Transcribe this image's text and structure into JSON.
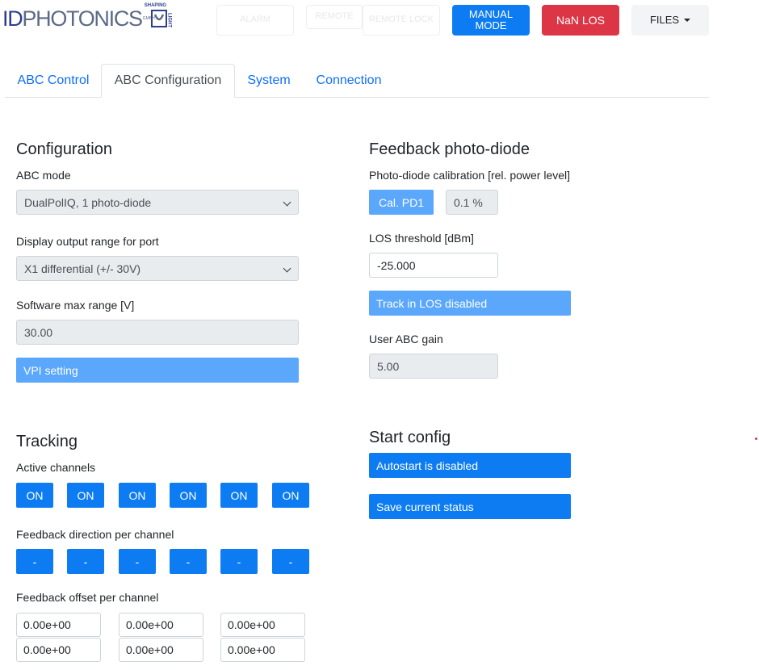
{
  "header": {
    "logo": {
      "id": "ID",
      "rest": "PHOTONICS",
      "shaping": "SHAPING",
      "gmbh": "GMBH",
      "light": "LIGHT"
    },
    "ghost_buttons": [
      "ALARM",
      "REMOTE",
      "REMOTE LOCK"
    ],
    "manual_mode": "MANUAL MODE",
    "nan_los": "NaN LOS",
    "files": "FILES"
  },
  "tabs": [
    {
      "label": "ABC Control",
      "active": false
    },
    {
      "label": "ABC Configuration",
      "active": true
    },
    {
      "label": "System",
      "active": false
    },
    {
      "label": "Connection",
      "active": false
    }
  ],
  "configuration": {
    "title": "Configuration",
    "abc_mode_label": "ABC mode",
    "abc_mode_value": "DualPolIQ, 1 photo-diode",
    "display_range_label": "Display output range for port",
    "display_range_value": "X1 differential (+/- 30V)",
    "sw_max_label": "Software max range [V]",
    "sw_max_value": "30.00",
    "vpi_button": "VPI setting"
  },
  "feedback": {
    "title": "Feedback photo-diode",
    "calib_label": "Photo-diode calibration [rel. power level]",
    "cal_button": "Cal. PD1",
    "cal_value": "0.1 %",
    "los_label": "LOS threshold [dBm]",
    "los_value": "-25.000",
    "track_los_button": "Track in LOS disabled",
    "gain_label": "User ABC gain",
    "gain_value": "5.00"
  },
  "tracking": {
    "title": "Tracking",
    "active_label": "Active channels",
    "active_channels": [
      "ON",
      "ON",
      "ON",
      "ON",
      "ON",
      "ON"
    ],
    "direction_label": "Feedback direction per channel",
    "directions": [
      "-",
      "-",
      "-",
      "-",
      "-",
      "-"
    ],
    "offset_label": "Feedback offset per channel",
    "offsets": [
      "0.00e+00",
      "0.00e+00",
      "0.00e+00",
      "0.00e+00",
      "0.00e+00",
      "0.00e+00"
    ]
  },
  "start_config": {
    "title": "Start config",
    "autostart_button": "Autostart is disabled",
    "save_button": "Save current status"
  },
  "colors": {
    "primary": "#0d7cf2",
    "primary_light": "#5aa7fb",
    "danger": "#dc3545",
    "tab_link": "#0d6efd"
  }
}
